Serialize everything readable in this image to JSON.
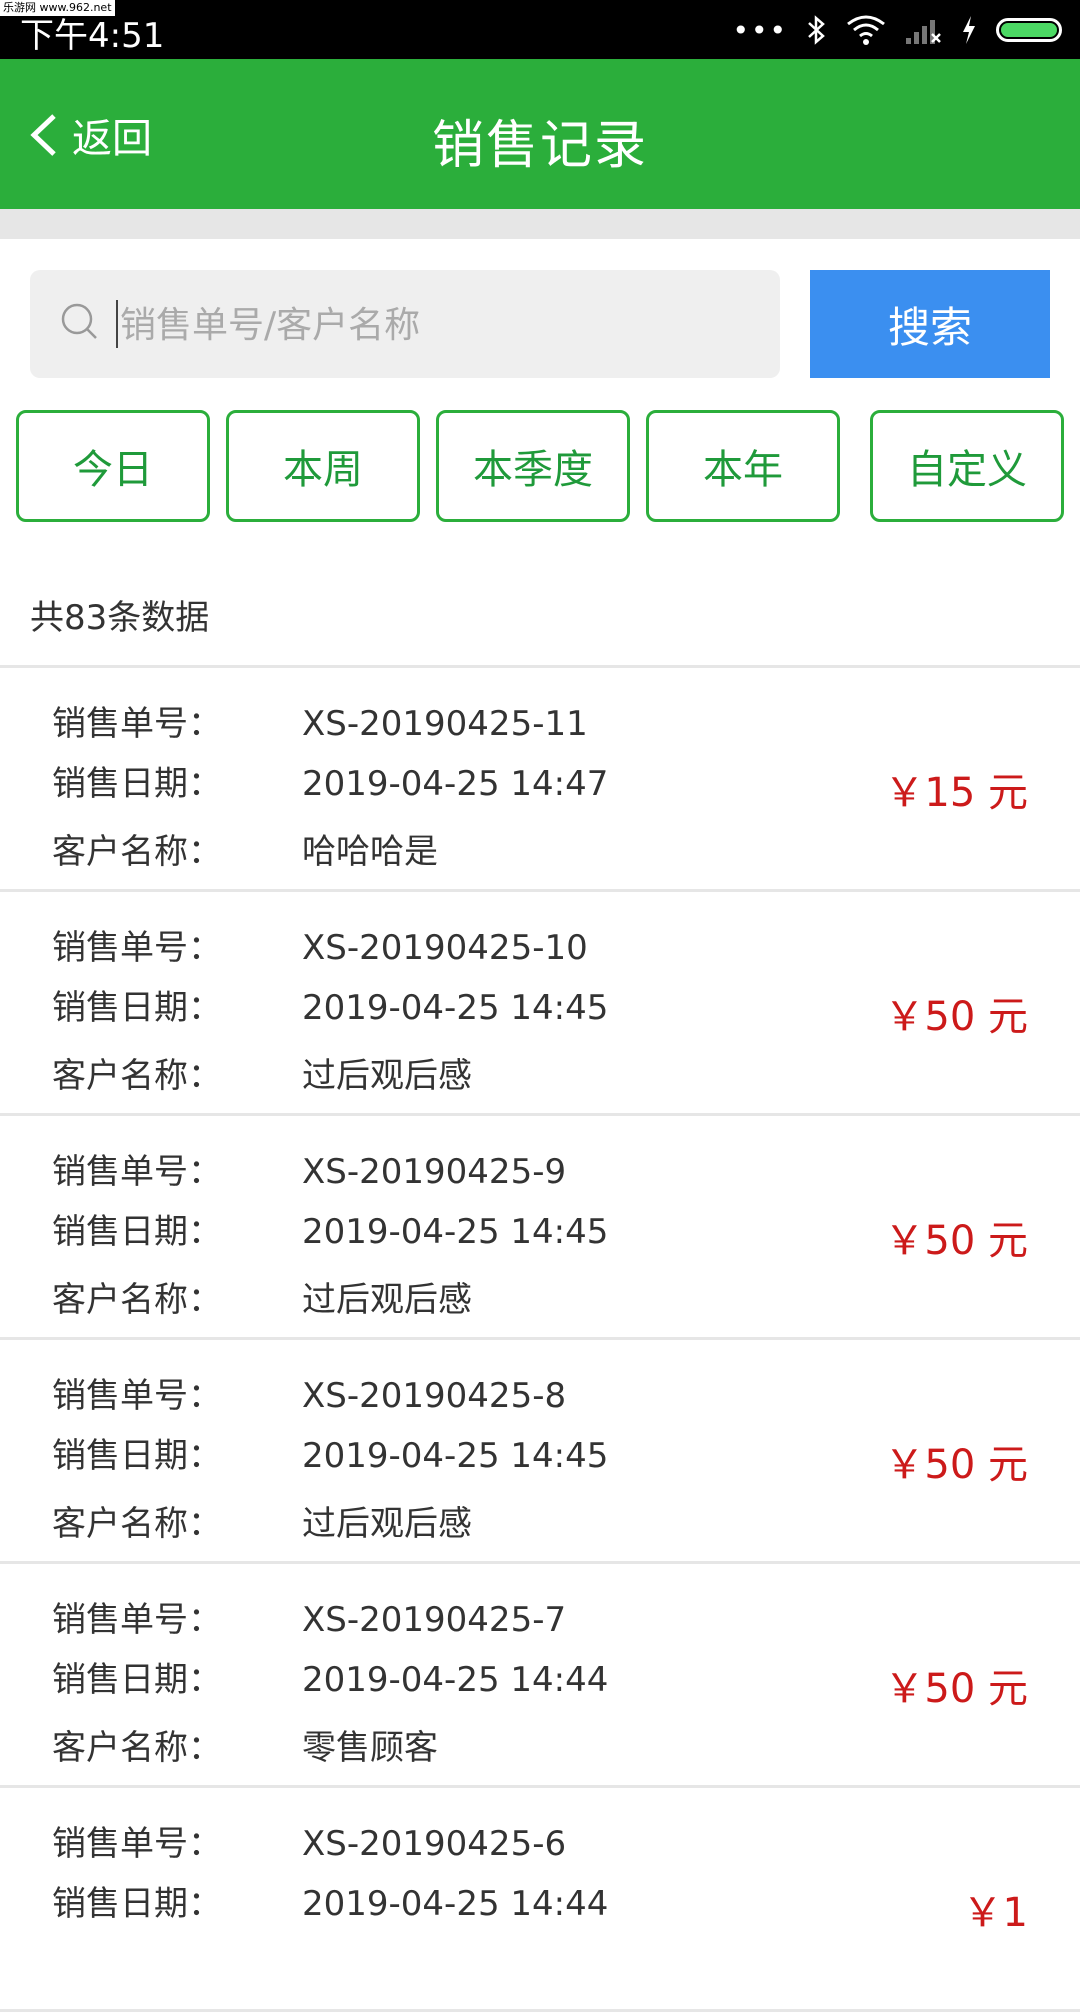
{
  "status_bar": {
    "time": "下午4:51",
    "watermark": "乐游网 www.962.net"
  },
  "header": {
    "back_label": "返回",
    "title": "销售记录"
  },
  "search": {
    "placeholder": "销售单号/客户名称",
    "button_label": "搜索"
  },
  "filters": [
    "今日",
    "本周",
    "本季度",
    "本年",
    "自定义"
  ],
  "summary": "共83条数据",
  "labels": {
    "order_no": "销售单号：",
    "date": "销售日期：",
    "customer": "客户名称："
  },
  "records": [
    {
      "order_no": "XS-20190425-11",
      "date": "2019-04-25 14:47",
      "customer": "哈哈哈是",
      "amount": "￥15 元"
    },
    {
      "order_no": "XS-20190425-10",
      "date": "2019-04-25 14:45",
      "customer": "过后观后感",
      "amount": "￥50 元"
    },
    {
      "order_no": "XS-20190425-9",
      "date": "2019-04-25 14:45",
      "customer": "过后观后感",
      "amount": "￥50 元"
    },
    {
      "order_no": "XS-20190425-8",
      "date": "2019-04-25 14:45",
      "customer": "过后观后感",
      "amount": "￥50 元"
    },
    {
      "order_no": "XS-20190425-7",
      "date": "2019-04-25 14:44",
      "customer": "零售顾客",
      "amount": "￥50 元"
    },
    {
      "order_no": "XS-20190425-6",
      "date": "2019-04-25 14:44",
      "customer": "",
      "amount": "￥1"
    }
  ],
  "colors": {
    "header_green": "#2bae3b",
    "search_blue": "#3b8ff0",
    "amount_red": "#cc1a1a"
  }
}
